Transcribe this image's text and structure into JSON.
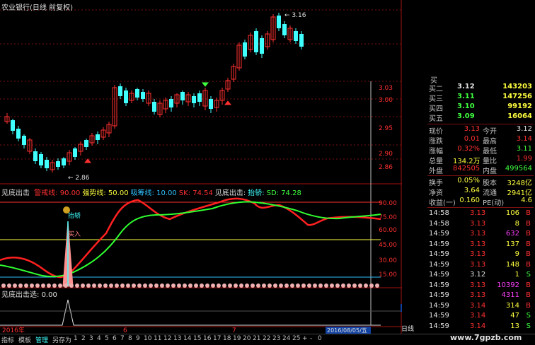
{
  "title": "农业银行(日线 前复权)",
  "price_axis_ticks": [
    "3.03",
    "3.00",
    "2.95",
    "2.90",
    "2.86"
  ],
  "price_annotations": {
    "high": "3.16",
    "low": "2.86"
  },
  "indicator1": {
    "name": "见底出击",
    "items": [
      {
        "label": "警戒线:",
        "value": "90.00",
        "color": "#ff3030"
      },
      {
        "label": "强势线:",
        "value": "50.00",
        "color": "#ffff40"
      },
      {
        "label": "吸筹线:",
        "value": "10.00",
        "color": "#30c0ff"
      },
      {
        "label": "SK:",
        "value": "74.54",
        "color": "#ff3030"
      },
      {
        "label": "见底出击:",
        "value": "",
        "color": "#e0e0e0"
      },
      {
        "label": "抬轿:",
        "value": "",
        "color": "#40ffff"
      },
      {
        "label": "SD:",
        "value": "74.28",
        "color": "#40ff40"
      }
    ],
    "axis_ticks": [
      "90.00",
      "75.00",
      "60.00",
      "45.00",
      "30.00",
      "15.00"
    ],
    "labels": {
      "taijiao": "抬轿",
      "mairu": "买入"
    }
  },
  "indicator2": {
    "name": "见底出击选",
    "value": "0.00",
    "marker": "0.54"
  },
  "timeline": {
    "year_label": "2016年",
    "month6": "6",
    "month7": "7",
    "date_box": "2016/08/05/五",
    "period": "日线"
  },
  "tabs": [
    "指标",
    "模板",
    "管理",
    "另存为",
    "1",
    "2",
    "3",
    "4",
    "5",
    "6",
    "7",
    "8",
    "9",
    "10",
    "11",
    "12",
    "13",
    "14",
    "15",
    "16",
    "17",
    "18",
    "19",
    "20",
    "21",
    "22",
    "23",
    "24",
    "25",
    "+",
    "-",
    "0"
  ],
  "order_book": [
    {
      "label": "买二",
      "price": "3.12",
      "vol": "143203",
      "pcolor": "#e0e0e0"
    },
    {
      "label": "买三",
      "price": "3.11",
      "vol": "147256",
      "pcolor": "#40ff40"
    },
    {
      "label": "买四",
      "price": "3.10",
      "vol": "99192",
      "pcolor": "#40ff40"
    },
    {
      "label": "买五",
      "price": "3.09",
      "vol": "16064",
      "pcolor": "#40ff40"
    }
  ],
  "stats": [
    {
      "l1": "现价",
      "v1": "3.13",
      "c1": "#ff3030",
      "l2": "今开",
      "v2": "3.12",
      "c2": "#e0e0e0"
    },
    {
      "l1": "涨跌",
      "v1": "0.01",
      "c1": "#ff3030",
      "l2": "最高",
      "v2": "3.14",
      "c2": "#ff3030"
    },
    {
      "l1": "涨幅",
      "v1": "0.32%",
      "c1": "#ff3030",
      "l2": "最低",
      "v2": "3.11",
      "c2": "#40ff40"
    },
    {
      "l1": "总量",
      "v1": "134.2万",
      "c1": "#ffff40",
      "l2": "量比",
      "v2": "1.99",
      "c2": "#ff3030"
    },
    {
      "l1": "外盘",
      "v1": "842505",
      "c1": "#ff3030",
      "l2": "内盘",
      "v2": "499564",
      "c2": "#40ff40"
    },
    {
      "l1": "换手",
      "v1": "0.05%",
      "c1": "#ffff40",
      "l2": "股本",
      "v2": "3248亿",
      "c2": "#ffff40"
    },
    {
      "l1": "净资",
      "v1": "3.64",
      "c1": "#ffff40",
      "l2": "流通",
      "v2": "2941亿",
      "c2": "#ffff40"
    },
    {
      "l1": "收益(一)",
      "v1": "0.160",
      "c1": "#ffff40",
      "l2": "PE(动)",
      "v2": "4.6",
      "c2": "#ffff40"
    }
  ],
  "trades": [
    {
      "t": "14:58",
      "p": "3.13",
      "pc": "#ff3030",
      "v": "106",
      "vc": "#ffff40",
      "d": "B",
      "dc": "#ff3030"
    },
    {
      "t": "14:58",
      "p": "3.13",
      "pc": "#ff3030",
      "v": "8",
      "vc": "#ffff40",
      "d": "B",
      "dc": "#ff3030"
    },
    {
      "t": "14:59",
      "p": "3.13",
      "pc": "#ff3030",
      "v": "632",
      "vc": "#ff40ff",
      "d": "B",
      "dc": "#ff3030"
    },
    {
      "t": "14:59",
      "p": "3.13",
      "pc": "#ff3030",
      "v": "137",
      "vc": "#ffff40",
      "d": "B",
      "dc": "#ff3030"
    },
    {
      "t": "14:59",
      "p": "3.13",
      "pc": "#ff3030",
      "v": "9",
      "vc": "#ffff40",
      "d": "B",
      "dc": "#ff3030"
    },
    {
      "t": "14:59",
      "p": "3.13",
      "pc": "#ff3030",
      "v": "148",
      "vc": "#ffff40",
      "d": "B",
      "dc": "#ff3030"
    },
    {
      "t": "14:59",
      "p": "3.12",
      "pc": "#e0e0e0",
      "v": "1",
      "vc": "#ffff40",
      "d": "S",
      "dc": "#40ff40"
    },
    {
      "t": "14:59",
      "p": "3.13",
      "pc": "#ff3030",
      "v": "10392",
      "vc": "#ff40ff",
      "d": "B",
      "dc": "#ff3030"
    },
    {
      "t": "14:59",
      "p": "3.13",
      "pc": "#ff3030",
      "v": "4311",
      "vc": "#ff40ff",
      "d": "B",
      "dc": "#ff3030"
    },
    {
      "t": "14:59",
      "p": "3.14",
      "pc": "#ff3030",
      "v": "314",
      "vc": "#ffff40",
      "d": "B",
      "dc": "#ff3030"
    },
    {
      "t": "14:59",
      "p": "3.14",
      "pc": "#ff3030",
      "v": "47",
      "vc": "#ffff40",
      "d": "S",
      "dc": "#40ff40"
    },
    {
      "t": "14:59",
      "p": "3.14",
      "pc": "#ff3030",
      "v": "13",
      "vc": "#ffff40",
      "d": "S",
      "dc": "#40ff40"
    }
  ],
  "watermark": "www.7gpzb.com",
  "colors": {
    "up": "#ff3030",
    "down": "#40ffff",
    "grid": "#7a1010",
    "sk": "#ff2020",
    "sd": "#30ff30"
  }
}
